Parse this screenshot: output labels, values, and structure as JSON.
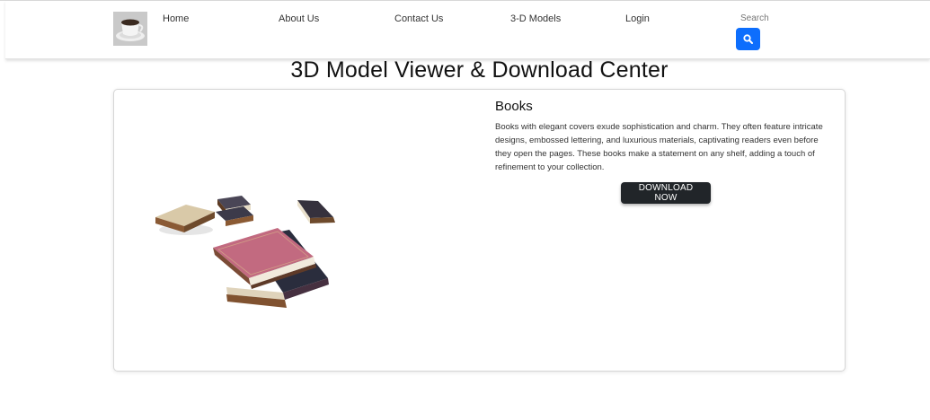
{
  "nav": {
    "links": [
      "Home",
      "About Us",
      "Contact Us",
      "3-D Models",
      "Login"
    ],
    "search_placeholder": "Search",
    "icons": {
      "logo": "coffee-cup-logo",
      "search": "search-icon"
    },
    "colors": {
      "search_button": "#0d6efd"
    }
  },
  "main": {
    "title": "3D Model Viewer & Download Center",
    "card": {
      "title": "Books",
      "description": "Books with elegant covers exude sophistication and charm. They often feature intricate designs, embossed lettering, and luxurious materials, captivating readers even before they open the pages. These books make a statement on any shelf, adding a touch of refinement to your collection.",
      "button_label": "DOWNLOAD NOW",
      "colors": {
        "button": "#212529"
      }
    }
  }
}
